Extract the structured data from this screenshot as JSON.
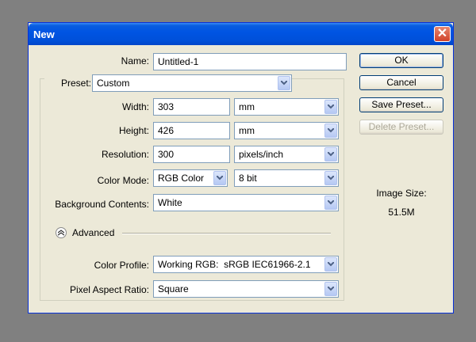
{
  "dialog": {
    "title": "New",
    "close_glyph": "✕",
    "name_label": "Name:",
    "name_value": "Untitled-1",
    "preset_label": "Preset:",
    "preset_value": "Custom",
    "width_label": "Width:",
    "width_value": "303",
    "width_unit": "mm",
    "height_label": "Height:",
    "height_value": "426",
    "height_unit": "mm",
    "resolution_label": "Resolution:",
    "resolution_value": "300",
    "resolution_unit": "pixels/inch",
    "color_mode_label": "Color Mode:",
    "color_mode_value": "RGB Color",
    "bit_depth_value": "8 bit",
    "background_label": "Background Contents:",
    "background_value": "White",
    "advanced_label": "Advanced",
    "color_profile_label": "Color Profile:",
    "color_profile_value": "Working RGB:  sRGB IEC61966-2.1",
    "pixel_aspect_label": "Pixel Aspect Ratio:",
    "pixel_aspect_value": "Square"
  },
  "buttons": {
    "ok": "OK",
    "cancel": "Cancel",
    "save_preset": "Save Preset...",
    "delete_preset": "Delete Preset..."
  },
  "info": {
    "image_size_label": "Image Size:",
    "image_size_value": "51.5M"
  },
  "colors": {
    "titlebar": "#0054e3",
    "dialog_bg": "#ece9d8",
    "desktop": "#808080"
  }
}
